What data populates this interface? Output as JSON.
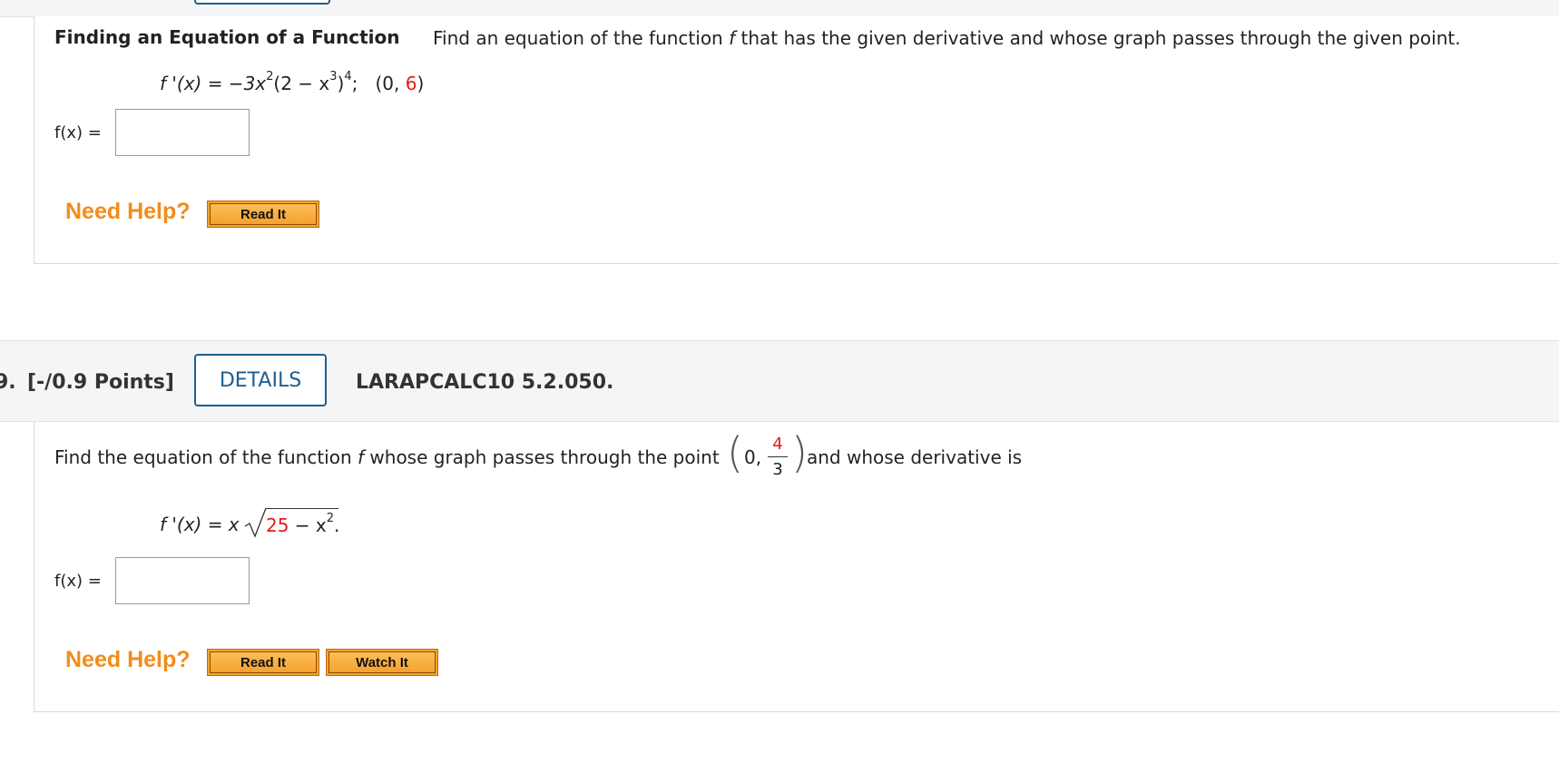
{
  "problem_prev": {
    "heading": "Finding an Equation of a Function",
    "instruction": "Find an equation of the function f that has the given derivative and whose graph passes through the given point.",
    "instruction_italic": "f",
    "instruction_before": "Find an equation of the function",
    "instruction_after": "that has the given derivative and whose graph passes through the given point.",
    "derivative_lhs": "f '(x) = −3x",
    "derivative_exp1": "2",
    "derivative_mid": "(2 − x",
    "derivative_exp2": "3",
    "derivative_close": ")",
    "derivative_exp3": "4",
    "derivative_sep": ";",
    "point_open": "(0, ",
    "point_y": "6",
    "point_close": ")",
    "answer_label": "f(x) =",
    "answer_value": "",
    "need_help": "Need Help?",
    "read_it": "Read It"
  },
  "problem_9": {
    "number": "9.",
    "points": "[-/0.9 Points]",
    "details_button": "DETAILS",
    "problem_id": "LARAPCALC10 5.2.050.",
    "instruction_before": "Find the equation of the function",
    "instruction_italic": "f",
    "instruction_mid": "whose graph passes through the point",
    "point_x": "0,",
    "point_numerator": "4",
    "point_denominator": "3",
    "instruction_after": "and whose derivative is",
    "derivative_lhs": "f '(x) = x",
    "radicand_number": "25",
    "radicand_rest": " − x",
    "radicand_exp": "2",
    "derivative_end": ".",
    "answer_label": "f(x) =",
    "answer_value": "",
    "need_help": "Need Help?",
    "read_it": "Read It",
    "watch_it": "Watch It"
  },
  "colors": {
    "accent_blue": "#1e5f8e",
    "help_orange": "#f28c1a",
    "highlight_red": "#e31b1b",
    "button_orange": "#f5a623"
  }
}
